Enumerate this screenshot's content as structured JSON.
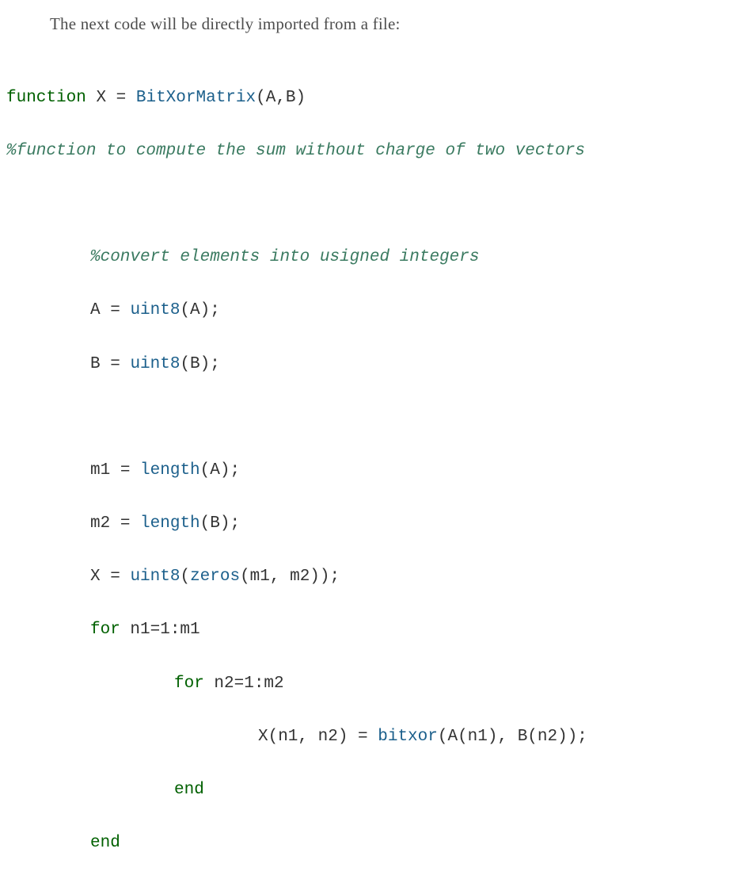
{
  "intro_text": "The next code will be directly imported from a file:",
  "code": {
    "line1": {
      "keyword_function": "function",
      "assign_left": "X",
      "equals": "=",
      "func_name": "BitXorMatrix",
      "args": "(A,B)"
    },
    "line2_comment": "%function to compute the sum without charge of two vectors",
    "line4_comment": "%convert elements into usigned integers",
    "line5": {
      "lhs": "A",
      "equals": "=",
      "builtin": "uint8",
      "args": "(A);"
    },
    "line6": {
      "lhs": "B",
      "equals": "=",
      "builtin": "uint8",
      "args": "(B);"
    },
    "line8": {
      "lhs": "m1",
      "equals": "=",
      "builtin": "length",
      "args": "(A);"
    },
    "line9": {
      "lhs": "m2",
      "equals": "=",
      "builtin": "length",
      "args": "(B);"
    },
    "line10": {
      "lhs": "X",
      "equals": "=",
      "builtin1": "uint8",
      "open1": "(",
      "builtin2": "zeros",
      "args2": "(m1, m2));"
    },
    "line11": {
      "keyword_for": "for",
      "loop": "n1=1:m1"
    },
    "line12": {
      "keyword_for": "for",
      "loop": "n2=1:m2"
    },
    "line13": {
      "lhs": "X(n1, n2)",
      "equals": "=",
      "builtin": "bitxor",
      "args": "(A(n1), B(n2));"
    },
    "line14_end": "end",
    "line15_end": "end"
  }
}
